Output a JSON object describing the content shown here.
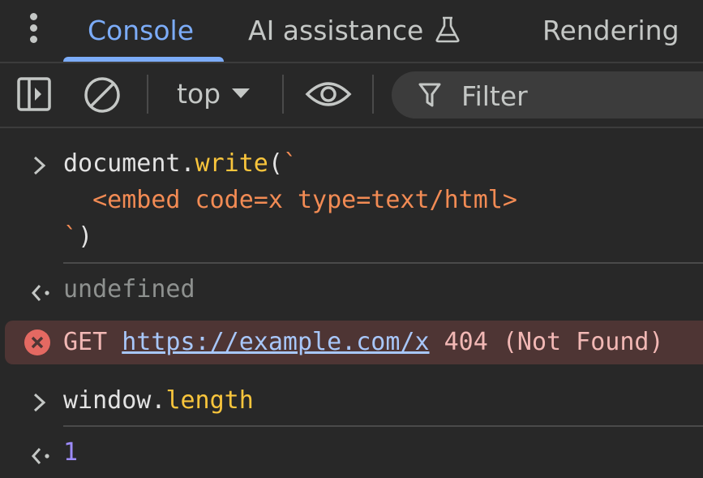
{
  "tabs": [
    {
      "label": "Console",
      "active": true
    },
    {
      "label": "AI assistance",
      "active": false,
      "icon": "flask-icon"
    },
    {
      "label": "Rendering",
      "active": false
    }
  ],
  "toolbar": {
    "context": "top",
    "filter_placeholder": "Filter"
  },
  "console": {
    "entry1": {
      "line1_obj": "document.",
      "line1_method": "write",
      "line1_paren": "(",
      "line1_tick": "`",
      "line2": "  <embed code=x type=text/html>",
      "line3_tick": "`",
      "line3_paren": ")"
    },
    "result1": "undefined",
    "error": {
      "prefix": "GET ",
      "url": "https://example.com/x",
      "suffix": " 404 (Not Found)"
    },
    "entry2": {
      "obj": "window.",
      "prop": "length"
    },
    "result2": "1"
  },
  "colors": {
    "accent": "#7cacf8",
    "method": "#f9c53c",
    "string": "#f28b54",
    "error_bg": "#4e3534",
    "error_icon": "#e46962",
    "number": "#9e8cff"
  }
}
